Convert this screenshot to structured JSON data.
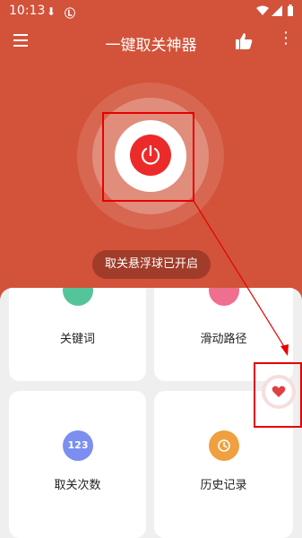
{
  "status_bar": {
    "time": "10:13",
    "icons": [
      "download-icon",
      "a-icon",
      "wifi-icon",
      "signal-icon",
      "battery-icon"
    ]
  },
  "app_bar": {
    "title": "一键取关神器",
    "icons": [
      "menu-icon",
      "thumbs-up-icon",
      "more-vert-icon"
    ]
  },
  "power": {
    "icon": "power-icon",
    "color": "#ec2a2a"
  },
  "status_toast": "取关悬浮球已开启",
  "tiles": [
    {
      "label": "关键词",
      "icon": "keyword-icon",
      "color": "#56c49a"
    },
    {
      "label": "滑动路径",
      "icon": "swipe-path-icon",
      "color": "#ef6f8f"
    },
    {
      "label": "取关次数",
      "icon": "count-123-icon",
      "icon_text": "123",
      "color": "#7c8ff0"
    },
    {
      "label": "历史记录",
      "icon": "history-clock-icon",
      "color": "#f0a040"
    }
  ],
  "floating_ball": {
    "icon": "heart-icon",
    "color": "#e04040"
  },
  "theme": {
    "primary": "#d2523a",
    "annotation": "#e60000"
  }
}
